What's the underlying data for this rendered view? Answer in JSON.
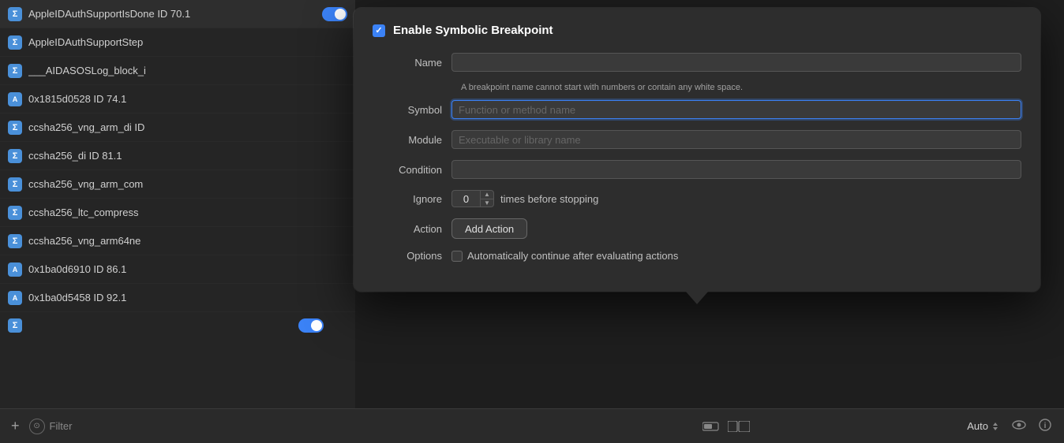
{
  "leftPanel": {
    "items": [
      {
        "id": "item-1",
        "badge": "Σ",
        "badgeType": "sigma",
        "label": "AppleIDAuthSupportIsDone  ID 70.1",
        "hasToggle": true
      },
      {
        "id": "item-2",
        "badge": "Σ",
        "badgeType": "sigma",
        "label": "AppleIDAuthSupportStep",
        "hasToggle": false
      },
      {
        "id": "item-3",
        "badge": "Σ",
        "badgeType": "sigma",
        "label": "___AIDASOSLog_block_i",
        "hasToggle": false
      },
      {
        "id": "item-4",
        "badge": "A",
        "badgeType": "addr",
        "label": "0x1815d0528  ID 74.1",
        "hasToggle": false
      },
      {
        "id": "item-5",
        "badge": "Σ",
        "badgeType": "sigma",
        "label": "ccsha256_vng_arm_di  ID",
        "hasToggle": false
      },
      {
        "id": "item-6",
        "badge": "Σ",
        "badgeType": "sigma",
        "label": "ccsha256_di  ID 81.1",
        "hasToggle": false
      },
      {
        "id": "item-7",
        "badge": "Σ",
        "badgeType": "sigma",
        "label": "ccsha256_vng_arm_com",
        "hasToggle": false
      },
      {
        "id": "item-8",
        "badge": "Σ",
        "badgeType": "sigma",
        "label": "ccsha256_ltc_compress",
        "hasToggle": false
      },
      {
        "id": "item-9",
        "badge": "Σ",
        "badgeType": "sigma",
        "label": "ccsha256_vng_arm64ne",
        "hasToggle": false
      },
      {
        "id": "item-10",
        "badge": "A",
        "badgeType": "addr",
        "label": "0x1ba0d6910  ID 86.1",
        "hasToggle": false
      },
      {
        "id": "item-11",
        "badge": "A",
        "badgeType": "addr",
        "label": "0x1ba0d5458  ID 92.1",
        "hasToggle": false
      }
    ]
  },
  "bottomBar": {
    "addLabel": "+",
    "filterLabel": "Filter",
    "filterIcon": "⊙"
  },
  "toolbar": {
    "autoLabel": "Auto",
    "eyeIcon": "👁",
    "infoIcon": "ⓘ"
  },
  "popup": {
    "checkboxChecked": true,
    "title": "Enable Symbolic Breakpoint",
    "fields": {
      "name": {
        "label": "Name",
        "value": "",
        "placeholder": "",
        "hint": "A breakpoint name cannot start with numbers or contain any white space."
      },
      "symbol": {
        "label": "Symbol",
        "value": "",
        "placeholder": "Function or method name"
      },
      "module": {
        "label": "Module",
        "value": "",
        "placeholder": "Executable or library name"
      },
      "condition": {
        "label": "Condition",
        "value": "",
        "placeholder": ""
      },
      "ignore": {
        "label": "Ignore",
        "value": "0",
        "suffix": "times before stopping"
      },
      "action": {
        "label": "Action",
        "buttonLabel": "Add Action"
      },
      "options": {
        "label": "Options",
        "checkboxLabel": "Automatically continue after evaluating actions"
      }
    }
  }
}
